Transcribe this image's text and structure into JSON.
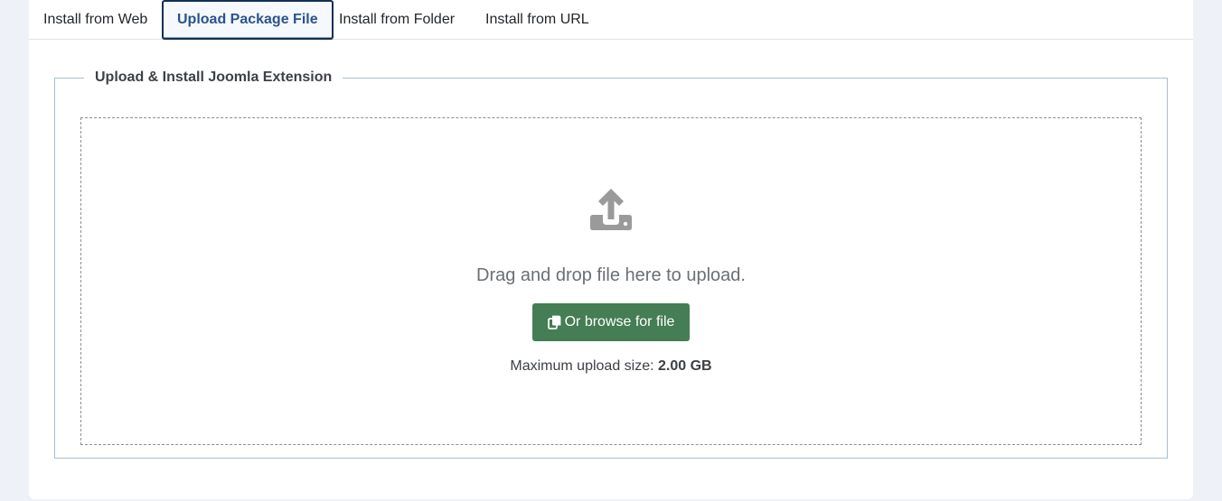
{
  "tabs": [
    {
      "label": "Install from Web"
    },
    {
      "label": "Upload Package File",
      "active": true
    },
    {
      "label": "Install from Folder"
    },
    {
      "label": "Install from URL"
    }
  ],
  "upload": {
    "legend": "Upload & Install Joomla Extension",
    "drop_text": "Drag and drop file here to upload.",
    "browse_label": "Or browse for file",
    "max_size_label": "Maximum upload size:",
    "max_size_value": "2.00 GB",
    "upload_icon": "upload-icon",
    "browse_icon": "copy-icon"
  },
  "colors": {
    "page_bg": "#eef1f8",
    "active_tab_text": "#2a5489",
    "active_tab_border": "#132f53",
    "browse_button": "#457d54",
    "icon_gray": "#9a9a9a"
  }
}
